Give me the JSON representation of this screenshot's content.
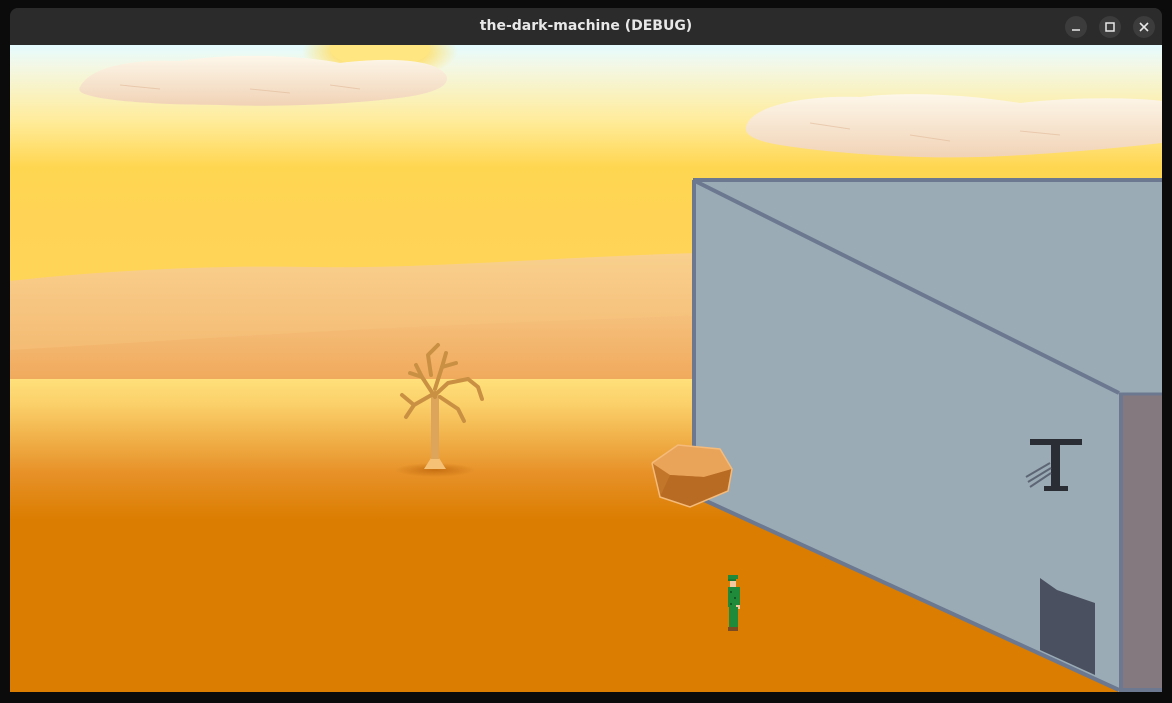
{
  "window": {
    "title": "the-dark-machine (DEBUG)"
  },
  "titlebar_controls": [
    {
      "name": "minimize",
      "icon": "minimize-icon"
    },
    {
      "name": "maximize",
      "icon": "maximize-icon"
    },
    {
      "name": "close",
      "icon": "close-icon"
    }
  ],
  "scene": {
    "sky_colors": [
      "#e4fbff",
      "#ffe27a",
      "#ffd44a"
    ],
    "dune_color": "#f6c27a",
    "desert_color": "#db7d00",
    "building_wall_color": "#9aabb5",
    "building_edge_color": "#6b7890",
    "building_side_color": "#84797f",
    "door_color": "#4a5060",
    "player_color": "#1e8a3a",
    "rock_color": "#e59a4a",
    "tree_color": "#d9a150"
  }
}
